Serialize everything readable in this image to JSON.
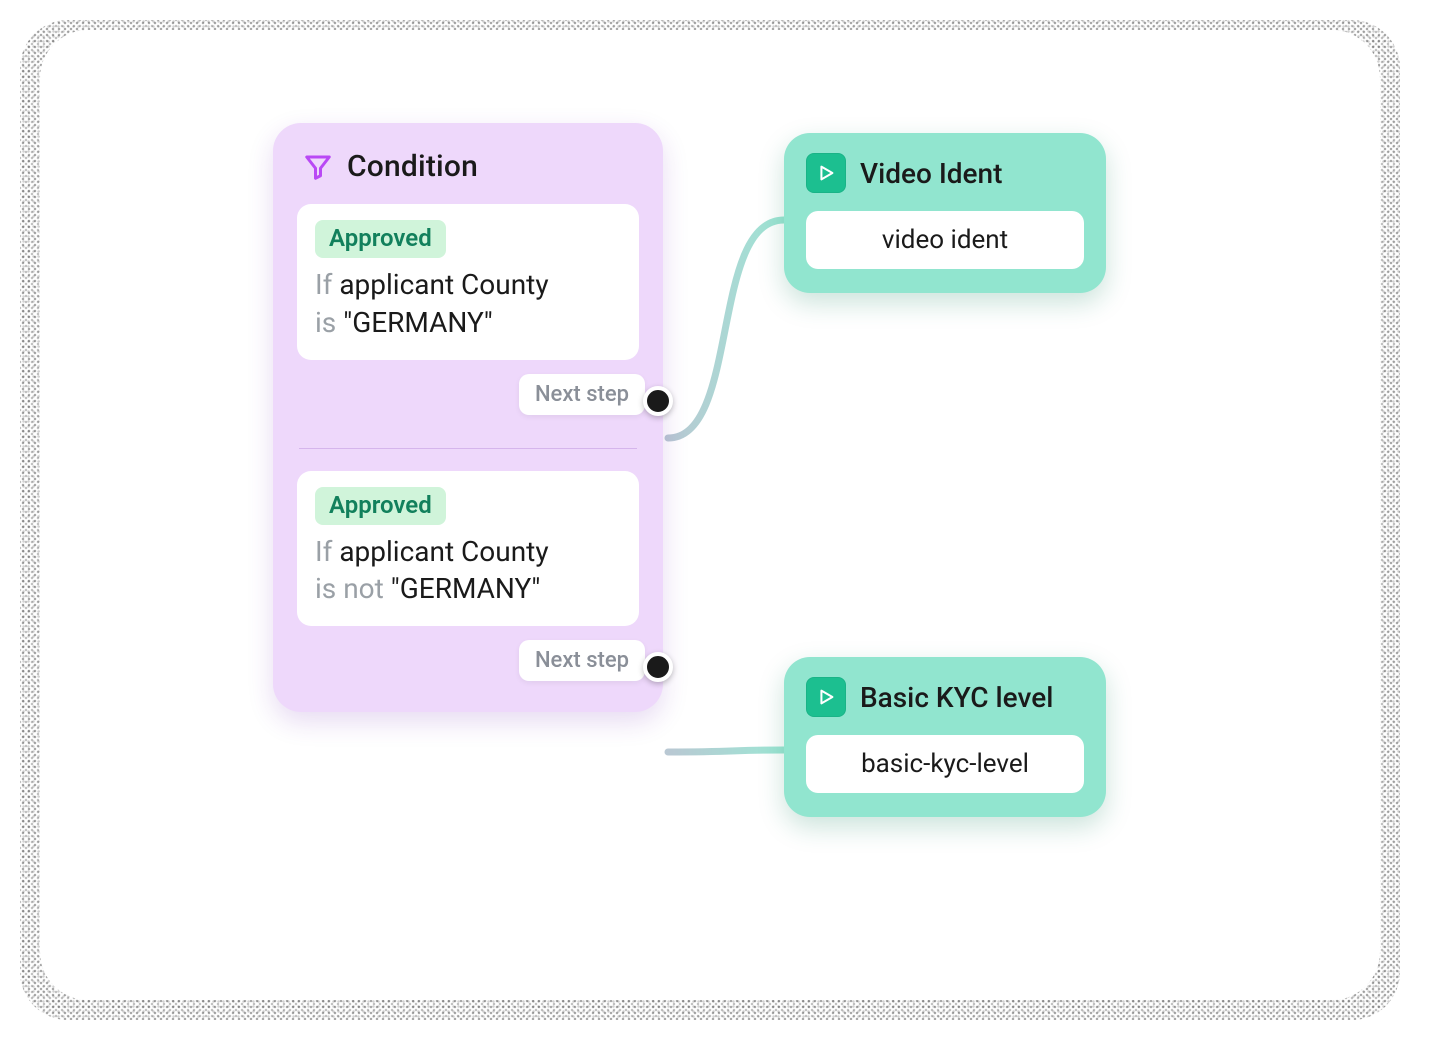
{
  "condition": {
    "title": "Condition",
    "rules": [
      {
        "status": "Approved",
        "prefix": "If",
        "subject": "applicant County",
        "operator": "is",
        "value": "\"GERMANY\"",
        "next_label": "Next step"
      },
      {
        "status": "Approved",
        "prefix": "If",
        "subject": "applicant County",
        "operator": "is not",
        "value": "\"GERMANY\"",
        "next_label": "Next step"
      }
    ]
  },
  "actions": [
    {
      "title": "Video Ident",
      "value": "video ident"
    },
    {
      "title": "Basic KYC level",
      "value": "basic-kyc-level"
    }
  ],
  "colors": {
    "condition_bg": "#eed8fb",
    "action_bg": "#91e5cf",
    "approved_bg": "#d0f4da",
    "approved_fg": "#12805c",
    "accent_purple": "#b949f5",
    "accent_teal": "#1cbf90"
  }
}
